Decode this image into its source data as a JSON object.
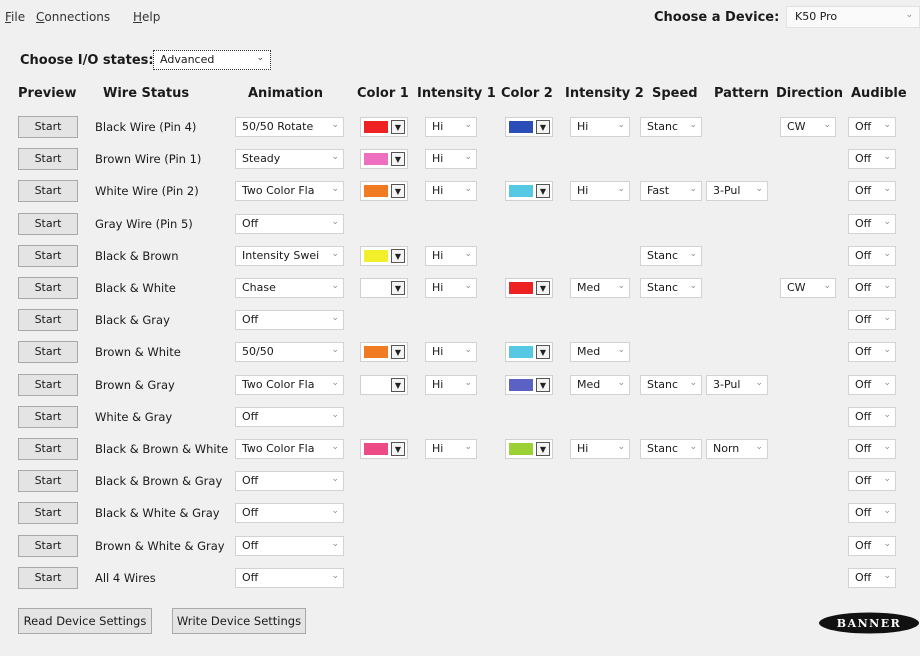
{
  "menu": {
    "file": {
      "first": "F",
      "rest": "ile"
    },
    "connections": {
      "first": "C",
      "rest": "onnections"
    },
    "help": {
      "first": "H",
      "rest": "elp"
    }
  },
  "device": {
    "label": "Choose a Device:",
    "value": "K50 Pro"
  },
  "io": {
    "label": "Choose I/O states:",
    "value": "Advanced"
  },
  "headers": {
    "preview": "Preview",
    "wire_status": "Wire Status",
    "animation": "Animation",
    "color1": "Color 1",
    "intensity1": "Intensity 1",
    "color2": "Color 2",
    "intensity2": "Intensity 2",
    "speed": "Speed",
    "pattern": "Pattern",
    "direction": "Direction",
    "audible": "Audible"
  },
  "start_label": "Start",
  "rows": [
    {
      "wire": "Black Wire (Pin 4)",
      "animation": "50/50 Rotate",
      "color1": "#ee2222",
      "intensity1": "Hi",
      "color2": "#2b4db8",
      "intensity2": "Hi",
      "speed": "Stanc",
      "pattern": "",
      "direction": "CW",
      "audible": "Off"
    },
    {
      "wire": "Brown Wire (Pin 1)",
      "animation": "Steady",
      "color1": "#ee6fc0",
      "intensity1": "Hi",
      "color2": "",
      "intensity2": "",
      "speed": "",
      "pattern": "",
      "direction": "",
      "audible": "Off"
    },
    {
      "wire": "White Wire (Pin 2)",
      "animation": "Two Color Fla",
      "color1": "#f07b22",
      "intensity1": "Hi",
      "color2": "#55c9e4",
      "intensity2": "Hi",
      "speed": "Fast",
      "pattern": "3-Pul",
      "direction": "",
      "audible": "Off"
    },
    {
      "wire": "Gray Wire (Pin 5)",
      "animation": "Off",
      "color1": "",
      "intensity1": "",
      "color2": "",
      "intensity2": "",
      "speed": "",
      "pattern": "",
      "direction": "",
      "audible": "Off"
    },
    {
      "wire": "Black & Brown",
      "animation": "Intensity Swei",
      "color1": "#f2ee2a",
      "intensity1": "Hi",
      "color2": "",
      "intensity2": "",
      "speed": "Stanc",
      "pattern": "",
      "direction": "",
      "audible": "Off"
    },
    {
      "wire": "Black & White",
      "animation": "Chase",
      "color1": "#ffffff",
      "intensity1": "Hi",
      "color2": "#ee2222",
      "intensity2": "Med",
      "speed": "Stanc",
      "pattern": "",
      "direction": "CW",
      "audible": "Off"
    },
    {
      "wire": "Black & Gray",
      "animation": "Off",
      "color1": "",
      "intensity1": "",
      "color2": "",
      "intensity2": "",
      "speed": "",
      "pattern": "",
      "direction": "",
      "audible": "Off"
    },
    {
      "wire": "Brown & White",
      "animation": "50/50",
      "color1": "#f07b22",
      "intensity1": "Hi",
      "color2": "#55c9e4",
      "intensity2": "Med",
      "speed": "",
      "pattern": "",
      "direction": "",
      "audible": "Off"
    },
    {
      "wire": "Brown & Gray",
      "animation": "Two Color Fla",
      "color1": "#ffffff",
      "intensity1": "Hi",
      "color2": "#5b62c4",
      "intensity2": "Med",
      "speed": "Stanc",
      "pattern": "3-Pul",
      "direction": "",
      "audible": "Off"
    },
    {
      "wire": "White & Gray",
      "animation": "Off",
      "color1": "",
      "intensity1": "",
      "color2": "",
      "intensity2": "",
      "speed": "",
      "pattern": "",
      "direction": "",
      "audible": "Off"
    },
    {
      "wire": "Black & Brown & White",
      "animation": "Two Color Fla",
      "color1": "#ee4a85",
      "intensity1": "Hi",
      "color2": "#9bd134",
      "intensity2": "Hi",
      "speed": "Stanc",
      "pattern": "Norn",
      "direction": "",
      "audible": "Off"
    },
    {
      "wire": "Black & Brown & Gray",
      "animation": "Off",
      "color1": "",
      "intensity1": "",
      "color2": "",
      "intensity2": "",
      "speed": "",
      "pattern": "",
      "direction": "",
      "audible": "Off"
    },
    {
      "wire": "Black & White & Gray",
      "animation": "Off",
      "color1": "",
      "intensity1": "",
      "color2": "",
      "intensity2": "",
      "speed": "",
      "pattern": "",
      "direction": "",
      "audible": "Off"
    },
    {
      "wire": "Brown & White & Gray",
      "animation": "Off",
      "color1": "",
      "intensity1": "",
      "color2": "",
      "intensity2": "",
      "speed": "",
      "pattern": "",
      "direction": "",
      "audible": "Off"
    },
    {
      "wire": "All 4 Wires",
      "animation": "Off",
      "color1": "",
      "intensity1": "",
      "color2": "",
      "intensity2": "",
      "speed": "",
      "pattern": "",
      "direction": "",
      "audible": "Off"
    }
  ],
  "buttons": {
    "read": "Read Device Settings",
    "write": "Write Device Settings"
  },
  "logo_text": "BANNER"
}
